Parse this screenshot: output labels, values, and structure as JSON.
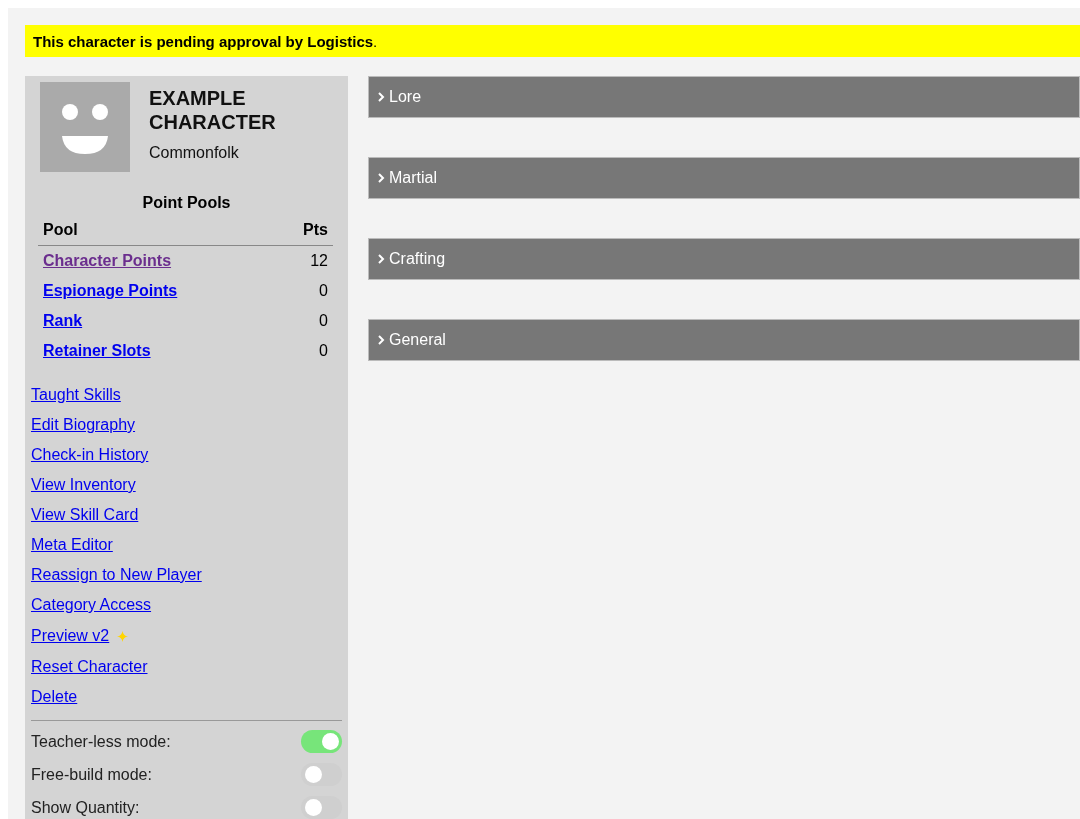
{
  "banner": {
    "text": "**This character is pending approval by Logistics**."
  },
  "character": {
    "name": "EXAMPLE CHARACTER",
    "subtitle": "Commonfolk"
  },
  "point_pools": {
    "title": "Point Pools",
    "columns": [
      "Pool",
      "Pts"
    ],
    "rows": [
      {
        "name": "Character Points",
        "pts": "12",
        "visited": true
      },
      {
        "name": "Espionage Points",
        "pts": "0",
        "visited": false
      },
      {
        "name": "Rank",
        "pts": "0",
        "visited": false
      },
      {
        "name": "Retainer Slots",
        "pts": "0",
        "visited": false
      }
    ]
  },
  "links": [
    {
      "label": "Taught Skills"
    },
    {
      "label": "Edit Biography"
    },
    {
      "label": "Check-in History"
    },
    {
      "label": "View Inventory"
    },
    {
      "label": "View Skill Card"
    },
    {
      "label": "Meta Editor"
    },
    {
      "label": "Reassign to New Player"
    },
    {
      "label": "Category Access"
    },
    {
      "label": "Preview v2",
      "kind": "new"
    },
    {
      "label": "Reset Character"
    },
    {
      "label": "Delete"
    }
  ],
  "toggles": [
    {
      "label": "Teacher-less mode:",
      "on": true
    },
    {
      "label": "Free-build mode:",
      "on": false
    },
    {
      "label": "Show Quantity:",
      "on": false
    }
  ],
  "sections": [
    {
      "label": "Lore",
      "expanded": false
    },
    {
      "label": "Martial",
      "expanded": false
    },
    {
      "label": "Crafting",
      "expanded": false
    },
    {
      "label": "General",
      "expanded": false
    }
  ]
}
